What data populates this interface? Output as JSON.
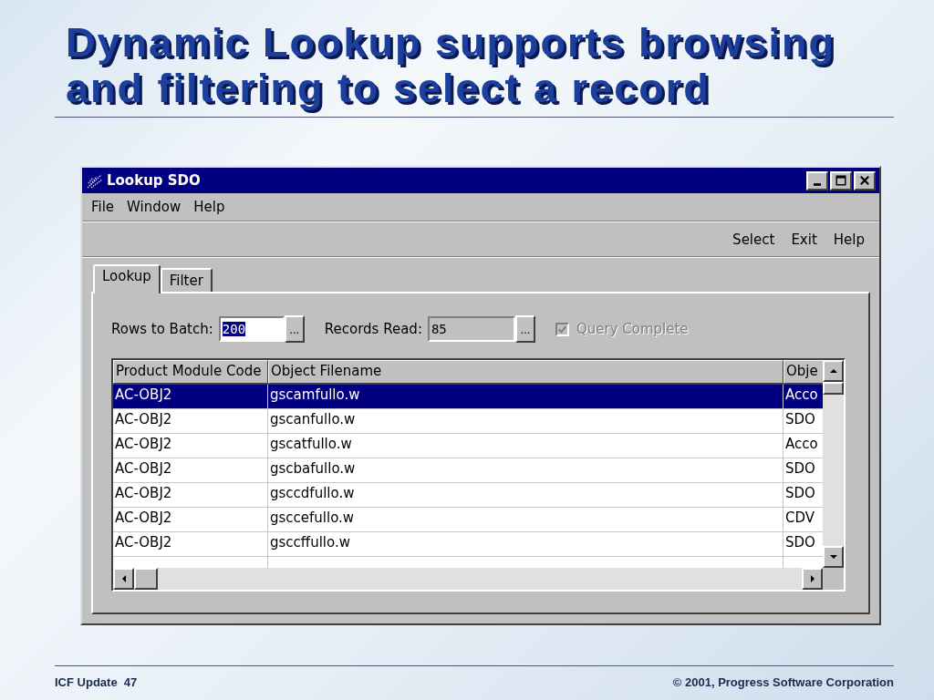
{
  "slide": {
    "title_lines": [
      "Dynamic Lookup supports browsing",
      "and filtering to select a record"
    ],
    "footer": {
      "left": "ICF Update  47",
      "right": "© 2001, Progress Software Corporation"
    }
  },
  "window": {
    "title": "Lookup SDO",
    "menu": [
      "File",
      "Window",
      "Help"
    ],
    "toolbar": [
      "Select",
      "Exit",
      "Help"
    ],
    "tabs": [
      {
        "label": "Lookup",
        "selected": true
      },
      {
        "label": "Filter",
        "selected": false
      }
    ],
    "rows_to_batch": {
      "label": "Rows to Batch:",
      "value": "200",
      "text_selected": true,
      "button": "..."
    },
    "records_read": {
      "label": "Records Read:",
      "value": "85",
      "button": "..."
    },
    "query_complete": {
      "label": "Query Complete",
      "checked": true,
      "disabled": true
    },
    "table": {
      "columns": [
        "Product Module Code",
        "Object Filename",
        "Obje"
      ],
      "rows": [
        {
          "cells": [
            "AC-OBJ2",
            "gscamfullo.w",
            "Acco"
          ],
          "selected": true
        },
        {
          "cells": [
            "AC-OBJ2",
            "gscanfullo.w",
            "SDO"
          ],
          "selected": false
        },
        {
          "cells": [
            "AC-OBJ2",
            "gscatfullo.w",
            "Acco"
          ],
          "selected": false
        },
        {
          "cells": [
            "AC-OBJ2",
            "gscbafullo.w",
            "SDO"
          ],
          "selected": false
        },
        {
          "cells": [
            "AC-OBJ2",
            "gsccdfullo.w",
            "SDO"
          ],
          "selected": false
        },
        {
          "cells": [
            "AC-OBJ2",
            "gsccefullo.w",
            "CDV"
          ],
          "selected": false
        },
        {
          "cells": [
            "AC-OBJ2",
            "gsccffullo.w",
            "SDO"
          ],
          "selected": false
        }
      ]
    }
  }
}
